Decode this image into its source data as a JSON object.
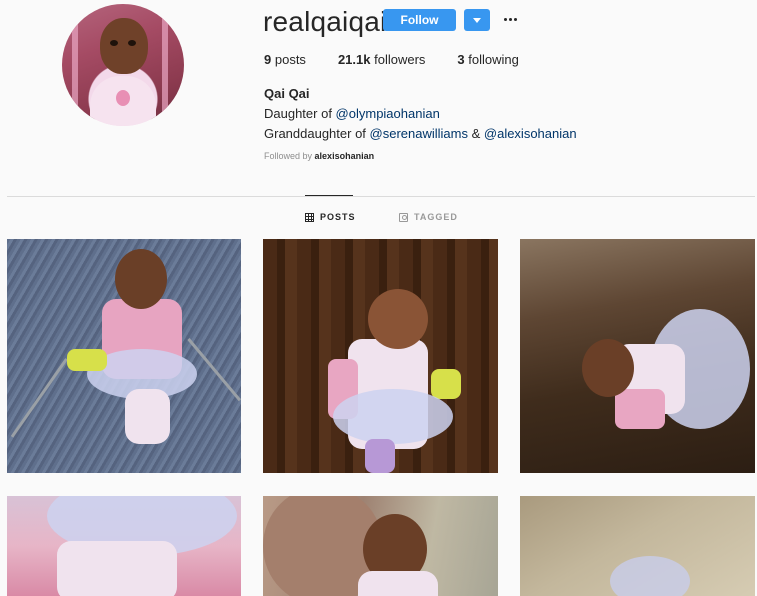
{
  "profile": {
    "username": "realqaiqai",
    "follow_label": "Follow",
    "stats": {
      "posts_count": "9",
      "posts_label": "posts",
      "followers_count": "21.1k",
      "followers_label": "followers",
      "following_count": "3",
      "following_label": "following"
    },
    "full_name": "Qai Qai",
    "bio": {
      "line1_prefix": "Daughter of ",
      "line1_mention": "@olympiaohanian",
      "line2_prefix": "Granddaughter of ",
      "line2_mention1": "@serenawilliams",
      "line2_sep": " & ",
      "line2_mention2": "@alexisohanian"
    },
    "followed_by_prefix": "Followed by",
    "followed_by_user": "alexisohanian"
  },
  "tabs": {
    "posts": "POSTS",
    "tagged": "TAGGED"
  },
  "icons": {
    "more": "more-options-icon",
    "dropdown": "chevron-down-icon",
    "posts_tab": "grid-icon",
    "tagged_tab": "tag-icon"
  },
  "colors": {
    "primary_button": "#3897f0",
    "mention": "#003569",
    "muted": "#8e8e8e"
  }
}
